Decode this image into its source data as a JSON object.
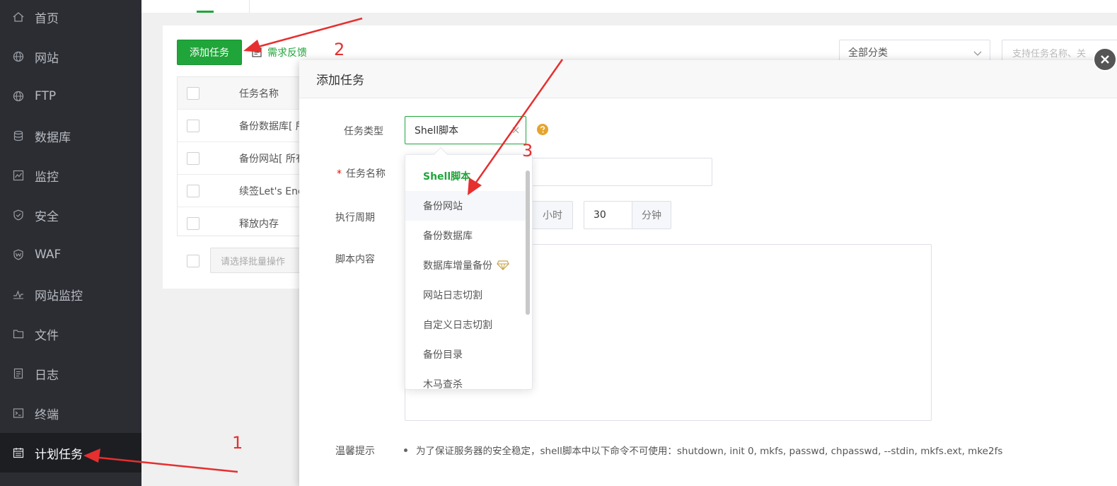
{
  "sidebar": {
    "items": [
      {
        "label": "首页",
        "icon": "home-icon"
      },
      {
        "label": "网站",
        "icon": "globe-icon"
      },
      {
        "label": "FTP",
        "icon": "globe-icon"
      },
      {
        "label": "数据库",
        "icon": "database-icon"
      },
      {
        "label": "监控",
        "icon": "monitor-icon"
      },
      {
        "label": "安全",
        "icon": "shield-icon"
      },
      {
        "label": "WAF",
        "icon": "shield-icon"
      },
      {
        "label": "网站监控",
        "icon": "pulse-icon"
      },
      {
        "label": "文件",
        "icon": "folder-icon"
      },
      {
        "label": "日志",
        "icon": "document-icon"
      },
      {
        "label": "终端",
        "icon": "terminal-icon"
      },
      {
        "label": "计划任务",
        "icon": "calendar-icon"
      }
    ]
  },
  "toolbar": {
    "add_label": "添加任务",
    "feedback_label": "需求反馈",
    "filter_value": "全部分类",
    "search_placeholder": "支持任务名称、关"
  },
  "table": {
    "header": "任务名称",
    "rows": [
      "备份数据库[ 所",
      "备份网站[ 所有",
      "续签Let's Encr",
      "释放内存"
    ]
  },
  "batch": {
    "placeholder": "请选择批量操作"
  },
  "modal": {
    "title": "添加任务",
    "type_label": "任务类型",
    "type_value": "Shell脚本",
    "name_label": "任务名称",
    "required_mark": "*",
    "period_label": "执行周期",
    "hour_unit": "小时",
    "minute_value": "30",
    "minute_unit": "分钟",
    "script_label": "脚本内容",
    "tips_label": "温馨提示",
    "tips_text": "为了保证服务器的安全稳定，shell脚本中以下命令不可使用：shutdown, init 0, mkfs, passwd, chpasswd, --stdin, mkfs.ext, mke2fs"
  },
  "dropdown": {
    "options": [
      "Shell脚本",
      "备份网站",
      "备份数据库",
      "数据库增量备份",
      "网站日志切割",
      "自定义日志切割",
      "备份目录",
      "木马查杀"
    ]
  },
  "annotations": {
    "labels": [
      "1",
      "2",
      "3"
    ],
    "color": "#e62f2f"
  },
  "colors": {
    "brand_green": "#20a53a",
    "sidebar_bg": "#2b2d33"
  }
}
